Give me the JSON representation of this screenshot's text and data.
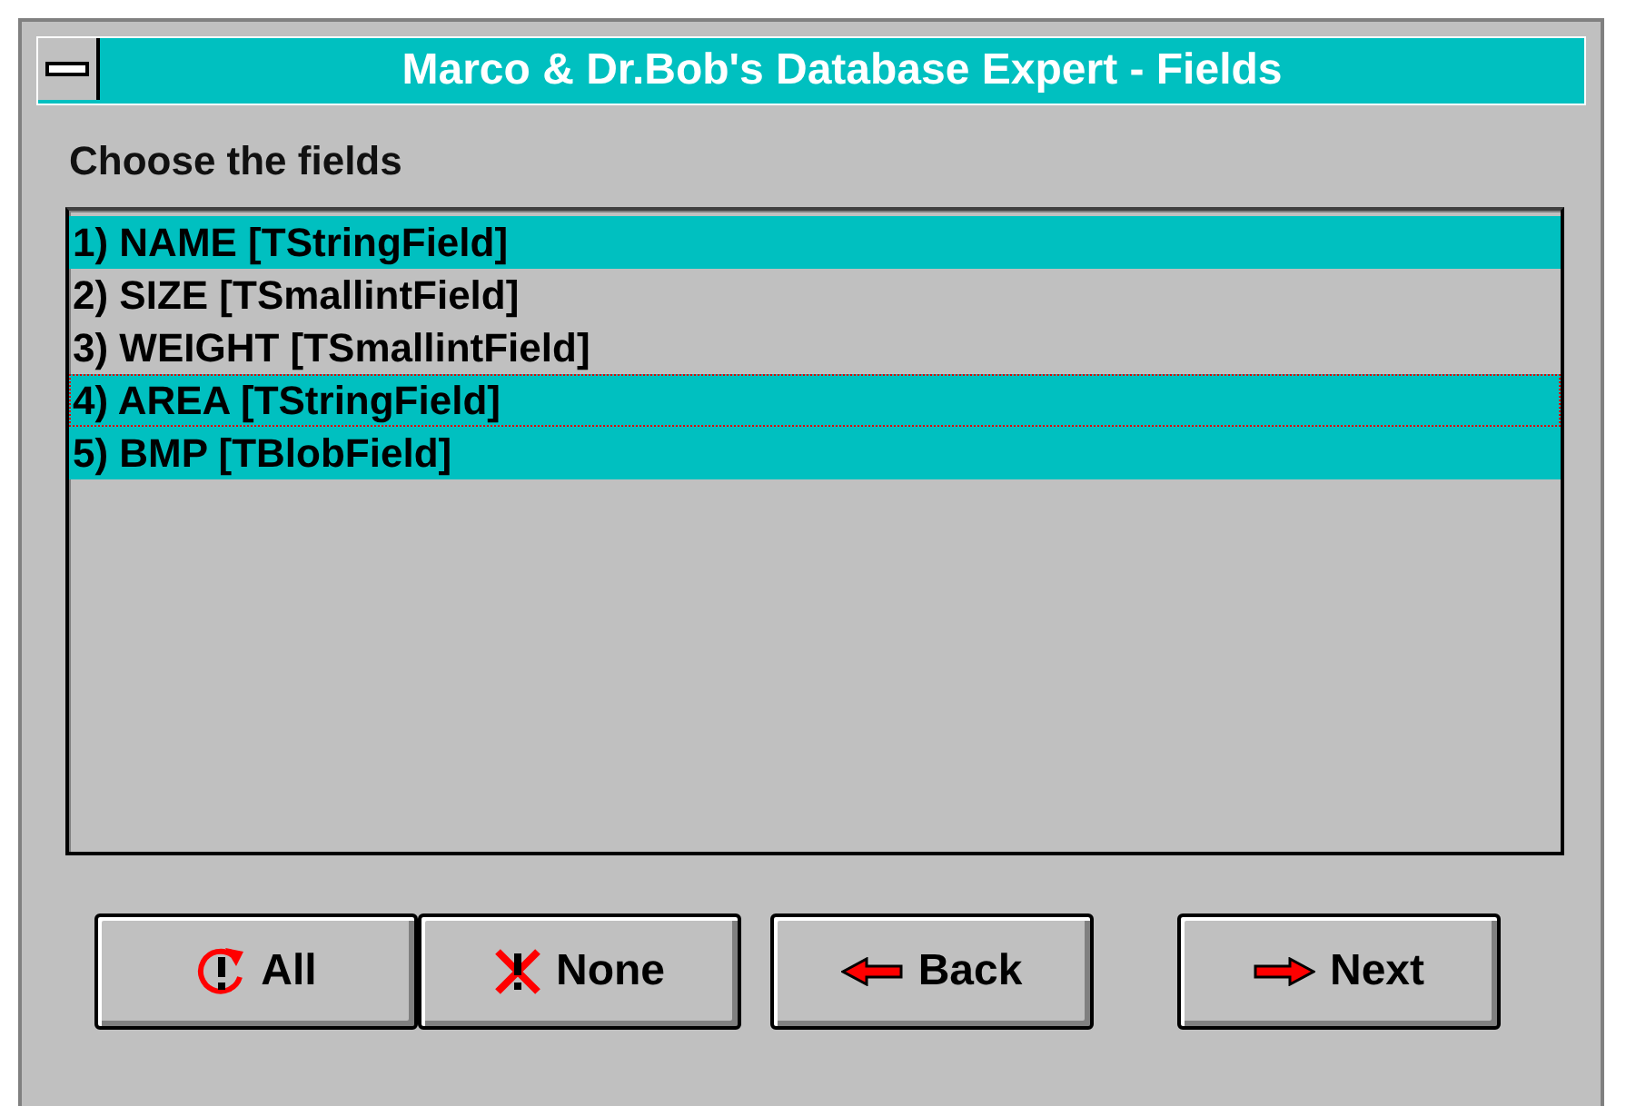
{
  "window": {
    "title": "Marco & Dr.Bob's Database Expert - Fields"
  },
  "prompt": "Choose the fields",
  "fields": [
    {
      "label": "1) NAME [TStringField]",
      "selected": true,
      "focused": false
    },
    {
      "label": "2) SIZE [TSmallintField]",
      "selected": false,
      "focused": false
    },
    {
      "label": "3) WEIGHT [TSmallintField]",
      "selected": false,
      "focused": false
    },
    {
      "label": "4) AREA [TStringField]",
      "selected": true,
      "focused": true
    },
    {
      "label": "5) BMP [TBlobField]",
      "selected": true,
      "focused": false
    }
  ],
  "buttons": [
    {
      "label": "All",
      "kind": "all"
    },
    {
      "label": "None",
      "kind": "none"
    },
    {
      "label": "Back",
      "kind": "back"
    },
    {
      "label": "Next",
      "kind": "next"
    }
  ]
}
